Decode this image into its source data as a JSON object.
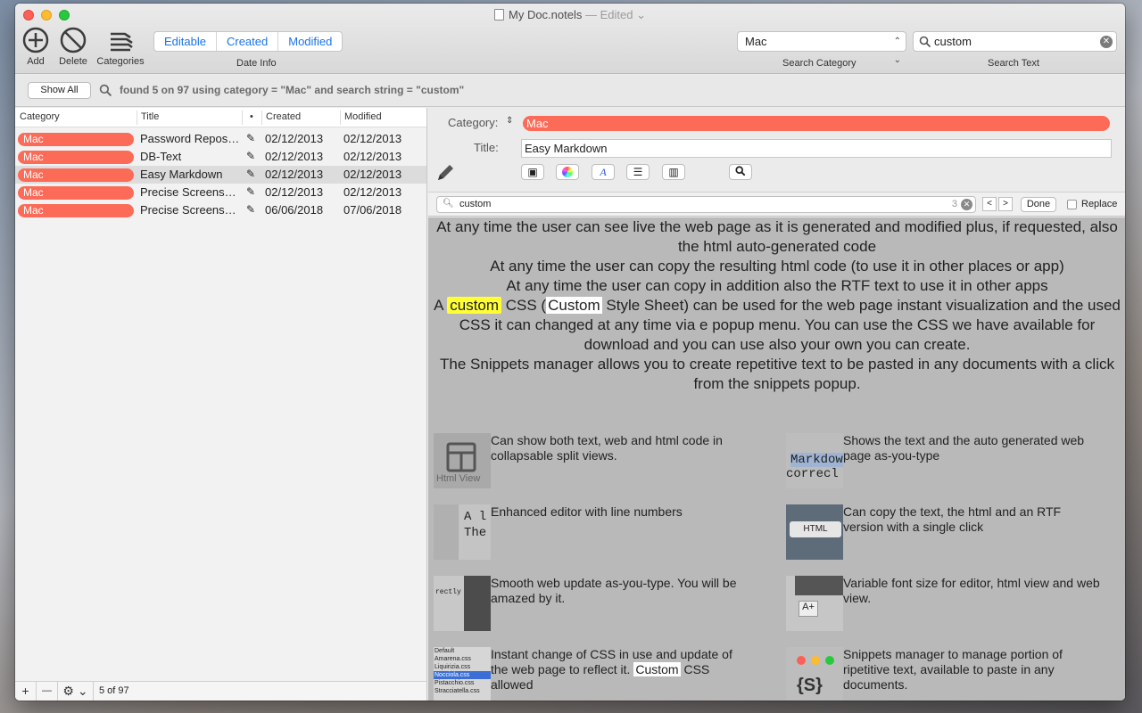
{
  "window": {
    "title": "My Doc.notels",
    "title_status": "— Edited"
  },
  "toolbar": {
    "add_label": "Add",
    "delete_label": "Delete",
    "categories_label": "Categories",
    "date_segments": [
      "Editable",
      "Created",
      "Modified"
    ],
    "date_info_label": "Date Info",
    "search_category_value": "Mac",
    "search_category_label": "Search Category",
    "search_text_value": "custom",
    "search_text_label": "Search Text"
  },
  "filterbar": {
    "show_all_label": "Show All",
    "status": "found 5 on 97 using  category = \"Mac\" and search string = \"custom\""
  },
  "table": {
    "columns": [
      "Category",
      "Title",
      "•",
      "Created",
      "Modified"
    ],
    "rows": [
      {
        "category": "Mac",
        "title": "Password Reposi…",
        "created": "02/12/2013",
        "modified": "02/12/2013"
      },
      {
        "category": "Mac",
        "title": "DB-Text",
        "created": "02/12/2013",
        "modified": "02/12/2013"
      },
      {
        "category": "Mac",
        "title": "Easy Markdown",
        "created": "02/12/2013",
        "modified": "02/12/2013"
      },
      {
        "category": "Mac",
        "title": "Precise Screenshot",
        "created": "02/12/2013",
        "modified": "02/12/2013"
      },
      {
        "category": "Mac",
        "title": "Precise Screensh…",
        "created": "06/06/2018",
        "modified": "07/06/2018"
      }
    ],
    "selected_index": 2
  },
  "bottombar": {
    "add": "+",
    "remove": "—",
    "gear_icon": "gear-icon",
    "count": "5 of 97"
  },
  "detail": {
    "category_label": "Category:",
    "category_value": "Mac",
    "title_label": "Title:",
    "title_value": "Easy Markdown"
  },
  "findbar": {
    "value": "custom",
    "count": "3",
    "done_label": "Done",
    "replace_label": "Replace"
  },
  "content": {
    "lines": [
      {
        "text": "At any time the user can see live the web page as it is generated and modified plus, if requested, also the html auto-generated code"
      },
      {
        "text": "At any time the user can copy the resulting html code (to use it in other places or app)"
      },
      {
        "text": "At any time the user can copy in addition also the RTF text to use it in other apps"
      }
    ],
    "css_line": {
      "pre": "A ",
      "hl": "custom",
      "mid1": " CSS (",
      "hl2": "Custom",
      "rest": " Style Sheet) can be used for the web page instant visualization and the used CSS it can changed at any time via e popup menu. You can use the CSS we have available for download and you can use also your own you can create."
    },
    "snippets_line": "The Snippets manager allows you to create repetitive text to be pasted in any documents with a click from the snippets popup.",
    "features": [
      {
        "text": "Can show both text, web and html code in collapsable split views.",
        "thumb": "Html View"
      },
      {
        "text": "Shows the text and the auto generated web page as-you-type",
        "thumb": "Markdow"
      },
      {
        "text": "Enhanced editor with line numbers",
        "thumb": "A l"
      },
      {
        "text": "Can copy the text, the html and an RTF version with a single click",
        "thumb": "HTML"
      },
      {
        "text": "Smooth web update as-you-type. You will be amazed by it.",
        "thumb": "rectly"
      },
      {
        "text": "Variable font size for editor, html view and web view.",
        "thumb": "A+"
      },
      {
        "text_pre": "Instant change of CSS in use and update of the web page to reflect it. ",
        "text_hl": "Custom",
        "text_post": " CSS allowed",
        "thumb_items": [
          "Default",
          "Amarena.css",
          "Liquirizia.css",
          "Nocciola.css",
          "Pistacchio.css",
          "Stracciatella.css"
        ]
      },
      {
        "text": "Snippets manager to manage portion of ripetitive text, available to paste in any documents.",
        "thumb": "{S}"
      }
    ]
  },
  "colors": {
    "category_pill": "#fb6b57",
    "accent": "#1a73e8",
    "highlight": "#ffff33"
  }
}
